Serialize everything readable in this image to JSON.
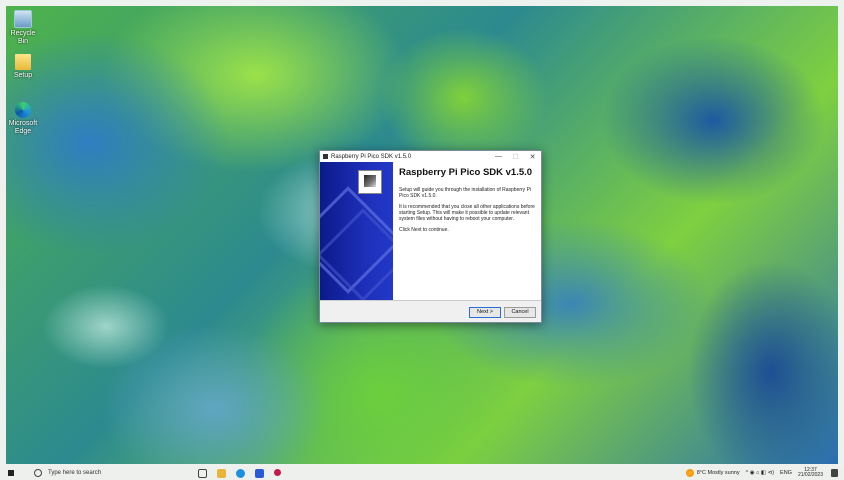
{
  "desktop": {
    "icons": [
      {
        "label": "Recycle Bin"
      },
      {
        "label": "Setup"
      },
      {
        "label": "Microsoft Edge"
      }
    ]
  },
  "installer": {
    "window_title": "Raspberry Pi Pico SDK v1.5.0",
    "heading": "Raspberry Pi Pico SDK v1.5.0",
    "paragraphs": [
      "Setup will guide you through the installation of Raspberry Pi Pico SDK v1.5.0.",
      "It is recommended that you close all other applications before starting Setup. This will make it possible to update relevant system files without having to reboot your computer.",
      "Click Next to continue."
    ],
    "next_label": "Next >",
    "cancel_label": "Cancel",
    "minimize": "—",
    "maximize": "☐",
    "close": "✕"
  },
  "taskbar": {
    "search_placeholder": "Type here to search",
    "weather": "8°C  Mostly sunny",
    "tray_symbols": "^  ◉  ⌂  ◧  ⊲)",
    "language": "ENG",
    "time": "12:37",
    "date": "21/02/2023",
    "colors": {
      "edge": "#1d8fe1",
      "explorer": "#e8b53a",
      "store": "#2a5bd7",
      "pi": "#c51a4a"
    }
  }
}
